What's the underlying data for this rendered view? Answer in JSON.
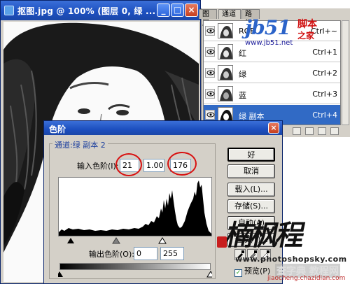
{
  "document_window": {
    "title": "抠图.jpg @ 100% (图层 0, 绿 ...",
    "minimize_label": "_",
    "maximize_label": "□",
    "close_label": "×"
  },
  "channels_panel": {
    "tabs": [
      "图层",
      "通道",
      "路径"
    ],
    "active_tab": "通道",
    "rows": [
      {
        "name": "RGB",
        "shortcut": "Ctrl+~",
        "selected": false
      },
      {
        "name": "红",
        "shortcut": "Ctrl+1",
        "selected": false
      },
      {
        "name": "绿",
        "shortcut": "Ctrl+2",
        "selected": false
      },
      {
        "name": "蓝",
        "shortcut": "Ctrl+3",
        "selected": false
      },
      {
        "name": "绿 副本",
        "shortcut": "Ctrl+4",
        "selected": true
      }
    ]
  },
  "watermark_jb51": {
    "logo": "jb51",
    "cn_top": "脚本",
    "cn_bottom": "之家",
    "url": "www.jb51.net"
  },
  "levels_dialog": {
    "title": "色阶",
    "close_label": "×",
    "channel_label": "通道:绿 副本 2",
    "input_levels_label": "输入色阶(I):",
    "input_black": "21",
    "input_gamma": "1.00",
    "input_white": "176",
    "output_levels_label": "输出色阶(O):",
    "output_black": "0",
    "output_white": "255",
    "buttons": {
      "ok": "好",
      "cancel": "取消",
      "load": "载入(L)...",
      "save": "存储(S)...",
      "auto": "自动(A)",
      "options": "选项(T)..."
    },
    "preview_label": "预览(P)",
    "preview_checked": true
  },
  "watermark_bottom": {
    "calligraphy": "楠枫程",
    "url": "www.photoshopsky.com",
    "cn_label": "查字典 教程网",
    "cn_url": "jiaocheng.chazidian.com"
  },
  "colors": {
    "titlebar": "#1c4fbf",
    "dialog_bg": "#d4d0c8",
    "selected_row": "#316ac5",
    "highlight_circle": "#d81010"
  }
}
